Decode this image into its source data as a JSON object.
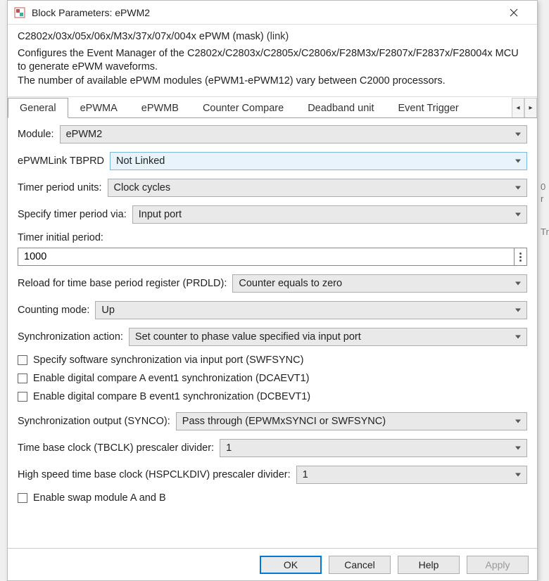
{
  "window": {
    "title": "Block Parameters: ePWM2"
  },
  "desc": {
    "line1a": "C2802x/03x/05x/06x/M3x/37x/07x/004x ePWM (mask) ",
    "line1_link": "(link)",
    "line2": "Configures the Event Manager of the C2802x/C2803x/C2805x/C2806x/F28M3x/F2807x/F2837x/F28004x MCU to generate ePWM waveforms.",
    "line3": "The number of available ePWM modules (ePWM1-ePWM12) vary between C2000 processors."
  },
  "tabs": {
    "items": [
      {
        "label": "General"
      },
      {
        "label": "ePWMA"
      },
      {
        "label": "ePWMB"
      },
      {
        "label": "Counter Compare"
      },
      {
        "label": "Deadband unit"
      },
      {
        "label": "Event Trigger"
      }
    ]
  },
  "fields": {
    "module": {
      "label": "Module:",
      "value": "ePWM2"
    },
    "link_tbprd": {
      "label": "ePWMLink TBPRD",
      "value": "Not Linked"
    },
    "timer_units": {
      "label": "Timer period units:",
      "value": "Clock cycles"
    },
    "spec_timer_via": {
      "label": "Specify timer period via:",
      "value": "Input port"
    },
    "timer_initial": {
      "label": "Timer initial period:",
      "value": "1000"
    },
    "reload_prdld": {
      "label": "Reload for time base period register (PRDLD):",
      "value": "Counter equals to zero"
    },
    "counting_mode": {
      "label": "Counting mode:",
      "value": "Up"
    },
    "sync_action": {
      "label": "Synchronization action:",
      "value": "Set counter to phase value specified via input port"
    },
    "cb_swfsync": {
      "label": "Specify software synchronization via input port (SWFSYNC)"
    },
    "cb_dcaevt1": {
      "label": "Enable digital compare A event1 synchronization (DCAEVT1)"
    },
    "cb_dcbevt1": {
      "label": "Enable digital compare B event1 synchronization (DCBEVT1)"
    },
    "synco": {
      "label": "Synchronization output (SYNCO):",
      "value": "Pass through (EPWMxSYNCI or SWFSYNC)"
    },
    "tbclk": {
      "label": "Time base clock (TBCLK) prescaler divider:",
      "value": "1"
    },
    "hspclk": {
      "label": "High speed time base clock (HSPCLKDIV) prescaler divider:",
      "value": "1"
    },
    "cb_swap": {
      "label": "Enable swap module A and B"
    }
  },
  "buttons": {
    "ok": "OK",
    "cancel": "Cancel",
    "help": "Help",
    "apply": "Apply"
  },
  "bg": {
    "h1": "0",
    "h2": "r",
    "h3": "Tr"
  }
}
